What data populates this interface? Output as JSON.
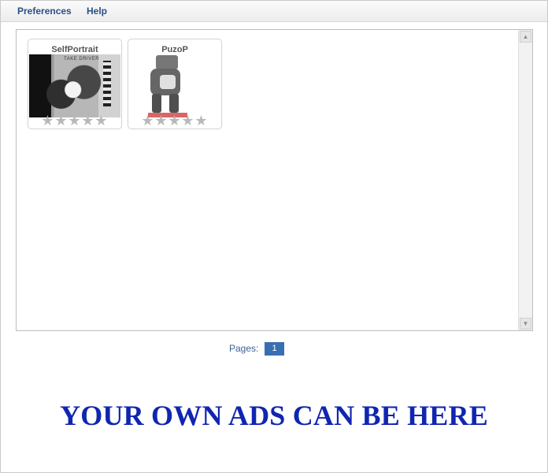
{
  "menu": {
    "items": [
      "Preferences",
      "Help"
    ]
  },
  "gallery": {
    "items": [
      {
        "title": "SelfPortrait",
        "rating": 0,
        "image_text": "TAKE DRIVER"
      },
      {
        "title": "PuzoP",
        "rating": 0,
        "image_text": ""
      }
    ]
  },
  "pagination": {
    "label": "Pages:",
    "current": "1"
  },
  "ad": {
    "text": "YOUR OWN ADS CAN BE HERE"
  },
  "colors": {
    "menu_text": "#2a4f86",
    "page_button": "#396fb0",
    "ad_text": "#1026b0"
  }
}
